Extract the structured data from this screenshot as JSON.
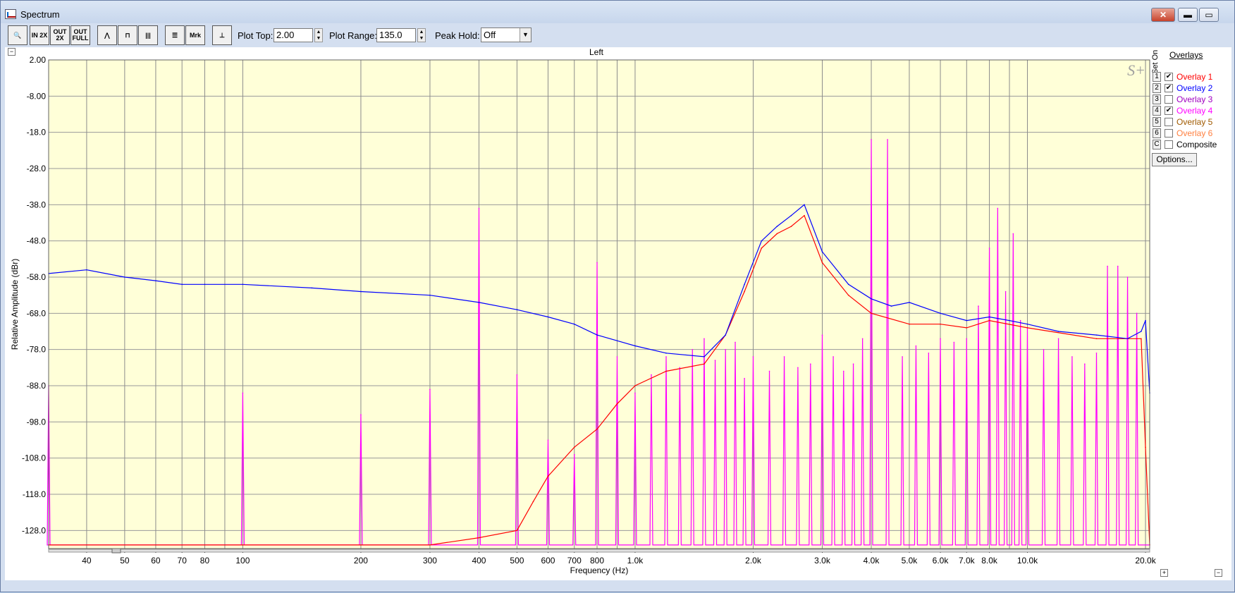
{
  "window": {
    "title": "Spectrum",
    "minimize": "▬",
    "maximize": "▭",
    "close": "✕"
  },
  "toolbar": {
    "buttons": [
      {
        "name": "zoom-icon",
        "label": "🔍"
      },
      {
        "name": "zoom-in-2x-button",
        "label": "IN 2X"
      },
      {
        "name": "zoom-out-2x-button",
        "label": "OUT 2X"
      },
      {
        "name": "zoom-out-full-button",
        "label": "OUT FULL"
      },
      {
        "name": "line-mode-button",
        "label": "⋀"
      },
      {
        "name": "bar-mode-button",
        "label": "⊓"
      },
      {
        "name": "octave-mode-button",
        "label": "|||"
      },
      {
        "name": "overlay-panel-button",
        "label": "☰"
      },
      {
        "name": "marker-button",
        "label": "Mrk"
      },
      {
        "name": "cursor-button",
        "label": "⊥"
      }
    ],
    "plot_top_label": "Plot Top:",
    "plot_top_value": "2.00",
    "plot_range_label": "Plot Range:",
    "plot_range_value": "135.0",
    "peak_hold_label": "Peak Hold:",
    "peak_hold_value": "Off"
  },
  "chart_panel": {
    "title": "Left",
    "watermark": "S+"
  },
  "overlays": {
    "heading": "Overlays",
    "set_on_label": "Set On",
    "items": [
      {
        "num": "1",
        "label": "Overlay 1",
        "checked": true,
        "color": "#ff0000"
      },
      {
        "num": "2",
        "label": "Overlay 2",
        "checked": true,
        "color": "#0000ff"
      },
      {
        "num": "3",
        "label": "Overlay 3",
        "checked": false,
        "color": "#a000c0"
      },
      {
        "num": "4",
        "label": "Overlay 4",
        "checked": true,
        "color": "#ff00ff"
      },
      {
        "num": "5",
        "label": "Overlay 5",
        "checked": false,
        "color": "#a05a00"
      },
      {
        "num": "6",
        "label": "Overlay 6",
        "checked": false,
        "color": "#ff8040"
      },
      {
        "num": "C",
        "label": "Composite",
        "checked": false,
        "color": "#000000"
      }
    ],
    "options_label": "Options..."
  },
  "chart_data": {
    "type": "line",
    "xlabel": "Frequency (Hz)",
    "ylabel": "Relative Amplitude (dBr)",
    "xscale": "log",
    "xlim": [
      32,
      20500
    ],
    "ylim": [
      -133,
      2
    ],
    "x_ticks": [
      40,
      50,
      60,
      70,
      80,
      100,
      200,
      300,
      400,
      500,
      600,
      700,
      800,
      1000,
      2000,
      3000,
      4000,
      5000,
      6000,
      7000,
      8000,
      10000,
      20000
    ],
    "x_tick_labels": [
      "40",
      "50",
      "60",
      "70",
      "80",
      "100",
      "200",
      "300",
      "400",
      "500",
      "600",
      "700",
      "800",
      "1.0k",
      "2.0k",
      "3.0k",
      "4.0k",
      "5.0k",
      "6.0k",
      "7.0k",
      "8.0k",
      "10.0k",
      "20.0k"
    ],
    "y_ticks": [
      2,
      -8,
      -18,
      -28,
      -38,
      -48,
      -58,
      -68,
      -78,
      -88,
      -98,
      -108,
      -118,
      -128
    ],
    "y_tick_labels": [
      "2.00",
      "-8.00",
      "-18.0",
      "-28.0",
      "-38.0",
      "-48.0",
      "-58.0",
      "-68.0",
      "-78.0",
      "-88.0",
      "-98.0",
      "-108.0",
      "-118.0",
      "-128.0"
    ],
    "grid": true,
    "background": "#ffffd8",
    "series": [
      {
        "name": "Overlay 2",
        "color": "#0000ff",
        "x": [
          32,
          40,
          50,
          60,
          70,
          80,
          100,
          150,
          200,
          300,
          400,
          500,
          600,
          700,
          800,
          1000,
          1200,
          1500,
          1700,
          1900,
          2100,
          2300,
          2500,
          2700,
          3000,
          3500,
          4000,
          4500,
          5000,
          6000,
          7000,
          8000,
          9000,
          10000,
          12000,
          15000,
          18000,
          19500,
          20000,
          20500
        ],
        "y": [
          -57,
          -56,
          -58,
          -59,
          -60,
          -60,
          -60,
          -61,
          -62,
          -63,
          -65,
          -67,
          -69,
          -71,
          -74,
          -77,
          -79,
          -80,
          -74,
          -60,
          -48,
          -44,
          -41,
          -38,
          -51,
          -60,
          -64,
          -66,
          -65,
          -68,
          -70,
          -69,
          -70,
          -71,
          -73,
          -74,
          -75,
          -73,
          -70,
          -90
        ]
      },
      {
        "name": "Overlay 1",
        "color": "#ff0000",
        "x": [
          32,
          100,
          200,
          300,
          400,
          500,
          550,
          600,
          700,
          800,
          900,
          1000,
          1200,
          1500,
          1700,
          1900,
          2100,
          2300,
          2500,
          2700,
          3000,
          3500,
          4000,
          5000,
          6000,
          7000,
          8000,
          10000,
          15000,
          19500,
          20000,
          20500
        ],
        "y": [
          -132,
          -132,
          -132,
          -132,
          -130,
          -128,
          -120,
          -113,
          -105,
          -100,
          -93,
          -88,
          -84,
          -82,
          -74,
          -62,
          -50,
          -46,
          -44,
          -41,
          -54,
          -63,
          -68,
          -71,
          -71,
          -72,
          -70,
          -72,
          -75,
          -75,
          -105,
          -132
        ]
      },
      {
        "name": "Overlay 4",
        "color": "#ff00ff",
        "baseline": -132,
        "peaks": [
          [
            32,
            -88
          ],
          [
            100,
            -90
          ],
          [
            200,
            -96
          ],
          [
            300,
            -89
          ],
          [
            400,
            -39
          ],
          [
            500,
            -85
          ],
          [
            600,
            -103
          ],
          [
            700,
            -107
          ],
          [
            800,
            -54
          ],
          [
            900,
            -80
          ],
          [
            1000,
            -90
          ],
          [
            1100,
            -85
          ],
          [
            1200,
            -80
          ],
          [
            1300,
            -83
          ],
          [
            1400,
            -78
          ],
          [
            1500,
            -75
          ],
          [
            1600,
            -81
          ],
          [
            1700,
            -78
          ],
          [
            1800,
            -76
          ],
          [
            1900,
            -86
          ],
          [
            2000,
            -80
          ],
          [
            2200,
            -84
          ],
          [
            2400,
            -80
          ],
          [
            2600,
            -83
          ],
          [
            2800,
            -82
          ],
          [
            3000,
            -74
          ],
          [
            3200,
            -80
          ],
          [
            3400,
            -84
          ],
          [
            3600,
            -82
          ],
          [
            3800,
            -75
          ],
          [
            4000,
            -20
          ],
          [
            4400,
            -20
          ],
          [
            4800,
            -80
          ],
          [
            5200,
            -77
          ],
          [
            5600,
            -79
          ],
          [
            6000,
            -75
          ],
          [
            6500,
            -76
          ],
          [
            7000,
            -75
          ],
          [
            7500,
            -66
          ],
          [
            8000,
            -50
          ],
          [
            8400,
            -39
          ],
          [
            8800,
            -62
          ],
          [
            9200,
            -46
          ],
          [
            9600,
            -70
          ],
          [
            10000,
            -72
          ],
          [
            11000,
            -78
          ],
          [
            12000,
            -75
          ],
          [
            13000,
            -80
          ],
          [
            14000,
            -82
          ],
          [
            15000,
            -79
          ],
          [
            16000,
            -55
          ],
          [
            17000,
            -55
          ],
          [
            18000,
            -58
          ],
          [
            19000,
            -68
          ]
        ]
      }
    ]
  }
}
